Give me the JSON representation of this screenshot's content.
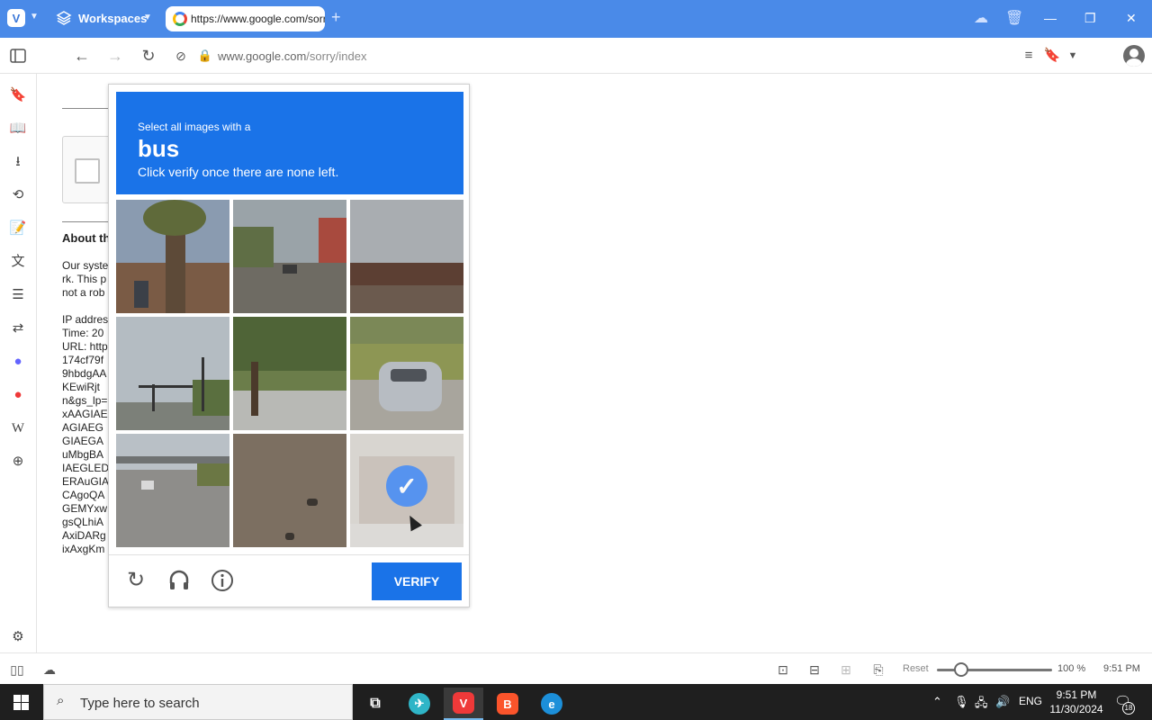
{
  "titlebar": {
    "workspaces_label": "Workspaces",
    "tab_url": "https://www.google.com/sorry/index"
  },
  "addressbar": {
    "domain": "www.google.com",
    "path": "/sorry/index"
  },
  "page": {
    "about_heading": "About th",
    "para1": [
      "Our syste",
      "rk. This p",
      "not a rob"
    ],
    "para2": [
      "IP addres",
      "Time: 20",
      "URL: http",
      "174cf79f",
      "9hbdgAA",
      "KEwiRjt",
      "n&gs_lp=",
      "xAAGIAE",
      "AGIAEG",
      "GIAEGA",
      "uMbgBA",
      "IAEGLED",
      "ERAuGIA",
      "CAgoQA",
      "GEMYxw",
      "gsQLhiA",
      "AxiDARg",
      "ixAxgKm"
    ]
  },
  "captcha": {
    "line1": "Select all images with a",
    "target_word": "bus",
    "line2": "Click verify once there are none left.",
    "verify_label": "VERIFY",
    "tiles": [
      {
        "subject": "palm tree and building",
        "selected": false
      },
      {
        "subject": "street with railway",
        "selected": false
      },
      {
        "subject": "building roof",
        "selected": false
      },
      {
        "subject": "traffic lights",
        "selected": false
      },
      {
        "subject": "tree and road",
        "selected": false
      },
      {
        "subject": "silver car",
        "selected": false
      },
      {
        "subject": "highway",
        "selected": false
      },
      {
        "subject": "road surface",
        "selected": false
      },
      {
        "subject": "building",
        "selected": true
      }
    ]
  },
  "statusbar": {
    "reset_label": "Reset",
    "zoom_level": 100,
    "zoom_label": "100 %",
    "time": "9:51 PM"
  },
  "taskbar": {
    "search_placeholder": "Type here to search",
    "language": "ENG",
    "time": "9:51 PM",
    "date": "11/30/2024",
    "notification_count": "18"
  },
  "colors": {
    "titlebar": "#4a8ae8",
    "captcha_blue": "#1a73e8",
    "taskbar": "#1f1f1f"
  }
}
